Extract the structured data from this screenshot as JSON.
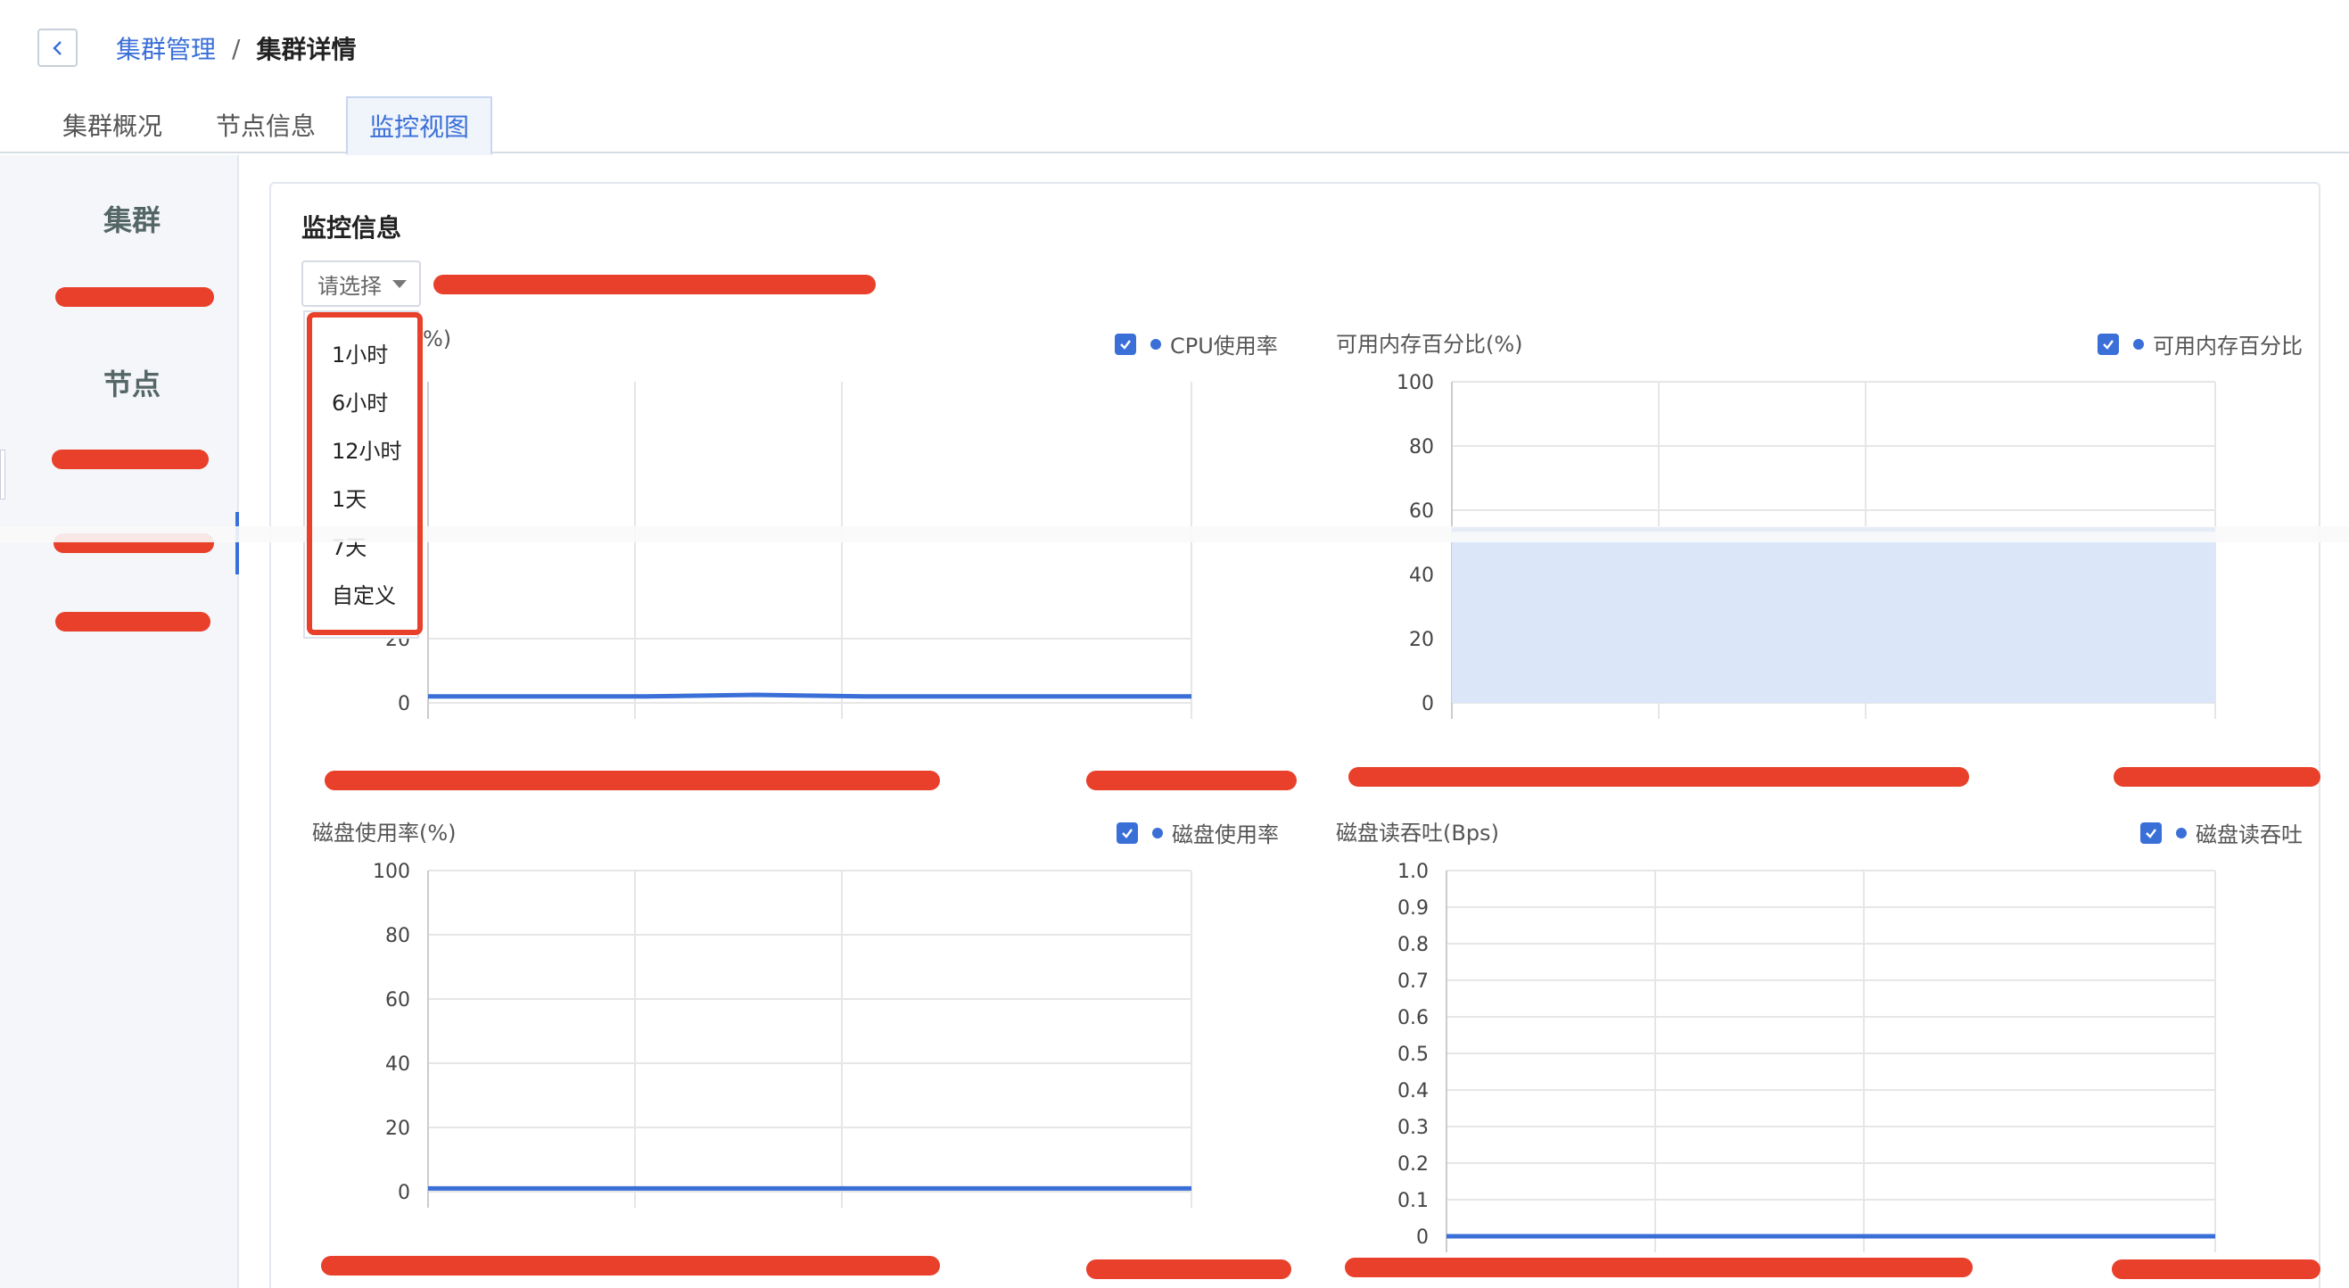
{
  "breadcrumb": {
    "parent": "集群管理",
    "separator": "/",
    "current": "集群详情"
  },
  "tabs": [
    {
      "label": "集群概况"
    },
    {
      "label": "节点信息"
    },
    {
      "label": "监控视图",
      "active": true
    }
  ],
  "sidebar": {
    "cluster_heading": "集群",
    "node_heading": "节点"
  },
  "main": {
    "title": "监控信息",
    "select": {
      "placeholder": "请选择"
    },
    "dropdown_options": [
      "1小时",
      "6小时",
      "12小时",
      "1天",
      "7天",
      "自定义"
    ]
  },
  "charts": {
    "cpu": {
      "title_visible": "%)",
      "legend": "CPU使用率"
    },
    "memory": {
      "title": "可用内存百分比(%)",
      "legend": "可用内存百分比"
    },
    "disk": {
      "title": "磁盘使用率(%)",
      "legend": "磁盘使用率"
    },
    "disk_io": {
      "title": "磁盘读吞吐(Bps)",
      "legend": "磁盘读吞吐"
    }
  },
  "chart_data": [
    {
      "type": "line",
      "ylabel": "%)",
      "ylim": [
        0,
        100
      ],
      "yticks": [
        "20",
        "0"
      ],
      "series": [
        {
          "name": "CPU使用率",
          "values": [
            2,
            2,
            2,
            2.5,
            2,
            2,
            2,
            2
          ]
        }
      ],
      "color": "#3a6fd8"
    },
    {
      "type": "area",
      "title": "可用内存百分比(%)",
      "ylim": [
        0,
        100
      ],
      "yticks": [
        "100",
        "80",
        "60",
        "40",
        "20",
        "0"
      ],
      "series": [
        {
          "name": "可用内存百分比",
          "values": [
            54,
            54,
            54,
            54,
            54,
            54,
            54,
            54
          ]
        }
      ],
      "color": "#3a6fd8",
      "fill": "#dbe6f8"
    },
    {
      "type": "line",
      "title": "磁盘使用率(%)",
      "ylim": [
        0,
        100
      ],
      "yticks": [
        "100",
        "80",
        "60",
        "40",
        "20",
        "0"
      ],
      "series": [
        {
          "name": "磁盘使用率",
          "values": [
            1,
            1,
            1,
            1,
            1,
            1,
            1,
            1
          ]
        }
      ],
      "color": "#3a6fd8"
    },
    {
      "type": "line",
      "title": "磁盘读吞吐(Bps)",
      "ylim": [
        0,
        1.0
      ],
      "yticks": [
        "1.0",
        "0.9",
        "0.8",
        "0.7",
        "0.6",
        "0.5",
        "0.4",
        "0.3",
        "0.2",
        "0.1",
        "0"
      ],
      "series": [
        {
          "name": "磁盘读吞吐",
          "values": [
            0,
            0,
            0,
            0,
            0,
            0,
            0,
            0
          ]
        }
      ],
      "color": "#3a6fd8"
    }
  ]
}
